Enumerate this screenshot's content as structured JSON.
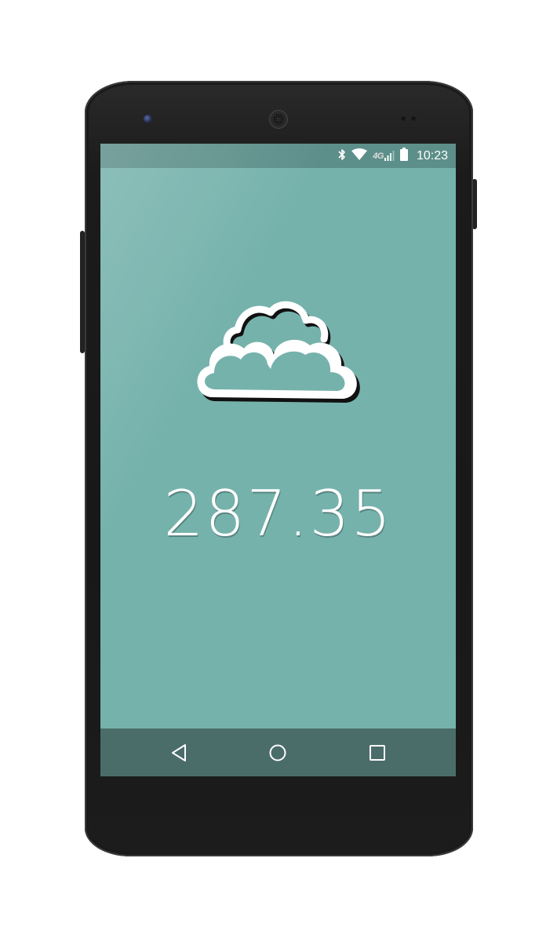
{
  "status_bar": {
    "time": "10:23",
    "network_label": "4G",
    "icons": [
      "bluetooth-icon",
      "wifi-icon",
      "network-4g-icon",
      "cell-signal-icon",
      "battery-icon"
    ]
  },
  "main": {
    "weather_icon": "cloud-icon",
    "value": "287.35"
  },
  "nav_bar": {
    "buttons": [
      "back-icon",
      "home-icon",
      "recent-apps-icon"
    ]
  },
  "colors": {
    "screen_background": "#76b2ac",
    "status_bar": "#5d8f8a",
    "nav_bar": "#4b6d6a",
    "text": "#ffffff"
  }
}
